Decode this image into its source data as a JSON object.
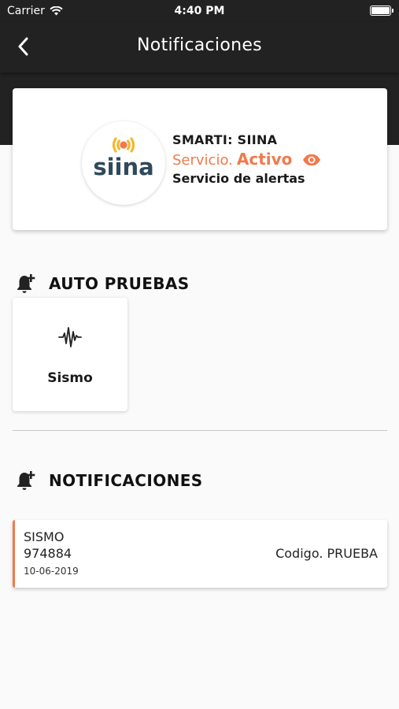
{
  "status_bar": {
    "carrier": "Carrier",
    "time": "4:40 PM"
  },
  "nav": {
    "title": "Notificaciones"
  },
  "service": {
    "logo_text": "siina",
    "name": "SMARTI: SIINA",
    "status_label": "Servicio.",
    "status_value": "Activo",
    "description": "Servicio de alertas"
  },
  "auto_tests": {
    "heading": "AUTO PRUEBAS",
    "items": [
      {
        "label": "Sismo",
        "icon": "seismic-wave-icon"
      }
    ]
  },
  "notifications": {
    "heading": "NOTIFICACIONES",
    "items": [
      {
        "type": "SISMO",
        "id": "974884",
        "date": "10-06-2019",
        "code": "Codigo. PRUEBA"
      }
    ]
  },
  "colors": {
    "bar": "#222222",
    "accent": "#f07a4c",
    "logo_text": "#2f4a5a",
    "logo_waves": "#f5b82e"
  }
}
